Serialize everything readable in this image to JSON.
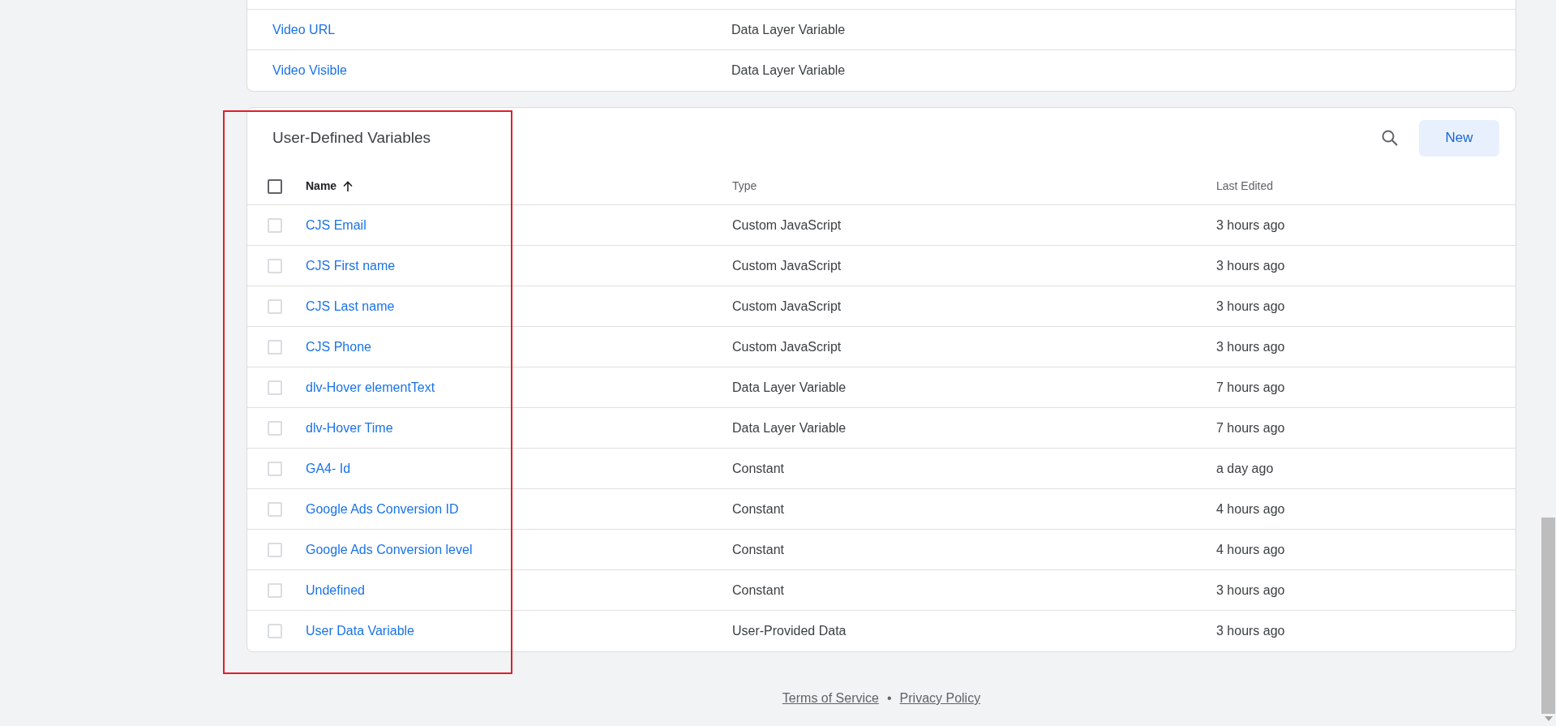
{
  "builtin_table": {
    "rows": [
      {
        "name": "Video URL",
        "type": "Data Layer Variable"
      },
      {
        "name": "Video Visible",
        "type": "Data Layer Variable"
      }
    ]
  },
  "user_defined": {
    "title": "User-Defined Variables",
    "new_button": "New",
    "header": {
      "checked": false,
      "columns": [
        {
          "label": "Name",
          "sorted": true
        },
        {
          "label": "Type",
          "sorted": false
        },
        {
          "label": "Last Edited",
          "sorted": false
        }
      ]
    },
    "rows": [
      {
        "name": "CJS Email",
        "type": "Custom JavaScript",
        "edited": "3 hours ago",
        "checked": false
      },
      {
        "name": "CJS First name",
        "type": "Custom JavaScript",
        "edited": "3 hours ago",
        "checked": false
      },
      {
        "name": "CJS Last name",
        "type": "Custom JavaScript",
        "edited": "3 hours ago",
        "checked": false
      },
      {
        "name": "CJS Phone",
        "type": "Custom JavaScript",
        "edited": "3 hours ago",
        "checked": false
      },
      {
        "name": "dlv-Hover elementText",
        "type": "Data Layer Variable",
        "edited": "7 hours ago",
        "checked": false
      },
      {
        "name": "dlv-Hover Time",
        "type": "Data Layer Variable",
        "edited": "7 hours ago",
        "checked": false
      },
      {
        "name": "GA4- Id",
        "type": "Constant",
        "edited": "a day ago",
        "checked": false
      },
      {
        "name": "Google Ads Conversion ID",
        "type": "Constant",
        "edited": "4 hours ago",
        "checked": false
      },
      {
        "name": "Google Ads Conversion level",
        "type": "Constant",
        "edited": "4 hours ago",
        "checked": false
      },
      {
        "name": "Undefined",
        "type": "Constant",
        "edited": "3 hours ago",
        "checked": false
      },
      {
        "name": "User Data Variable",
        "type": "User-Provided Data",
        "edited": "3 hours ago",
        "checked": false
      }
    ]
  },
  "footer": {
    "links": [
      "Terms of Service",
      "Privacy Policy"
    ],
    "separator": "•"
  }
}
